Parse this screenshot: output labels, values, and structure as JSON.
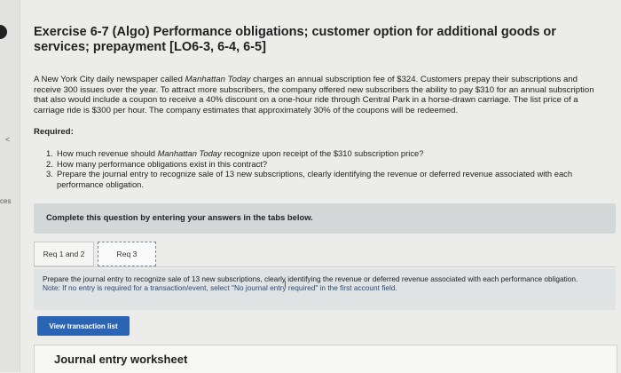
{
  "exercise": {
    "title": "Exercise 6-7 (Algo) Performance obligations; customer option for additional goods or services; prepayment [LO6-3, 6-4, 6-5]"
  },
  "intro": {
    "part1": "A New York City daily newspaper called ",
    "paper_name": "Manhattan Today",
    "part2": " charges an annual subscription fee of $324. Customers prepay their subscriptions and receive 300 issues over the year. To attract more subscribers, the company offered new subscribers the ability to pay $310 for an annual subscription that also would include a coupon to receive a 40% discount on a one-hour ride through Central Park in a horse-drawn carriage. The list price of a carriage ride is $300 per hour. The company estimates that approximately 30% of the coupons will be redeemed."
  },
  "required_label": "Required:",
  "questions": [
    {
      "num": "1.",
      "pre": "How much revenue should ",
      "em": "Manhattan Today",
      "post": " recognize upon receipt of the $310 subscription price?"
    },
    {
      "num": "2.",
      "pre": "How many performance obligations exist in this contract?",
      "em": "",
      "post": ""
    },
    {
      "num": "3.",
      "pre": "Prepare the journal entry to recognize sale of 13 new subscriptions, clearly identifying the revenue or deferred revenue associated with each performance obligation.",
      "em": "",
      "post": ""
    }
  ],
  "complete_bar": "Complete this question by entering your answers in the tabs below.",
  "tabs": [
    "Req 1 and 2",
    "Req 3"
  ],
  "panel": {
    "instruction": "Prepare the journal entry to recognize sale of 13 new subscriptions, clearly identifying the revenue or deferred revenue associated with each performance obligation.",
    "note": "Note: If no entry is required for a transaction/event, select \"No journal entry required\" in the first account field."
  },
  "view_button": "View transaction list",
  "worksheet_title": "Journal entry worksheet",
  "side": {
    "label": "ces"
  }
}
